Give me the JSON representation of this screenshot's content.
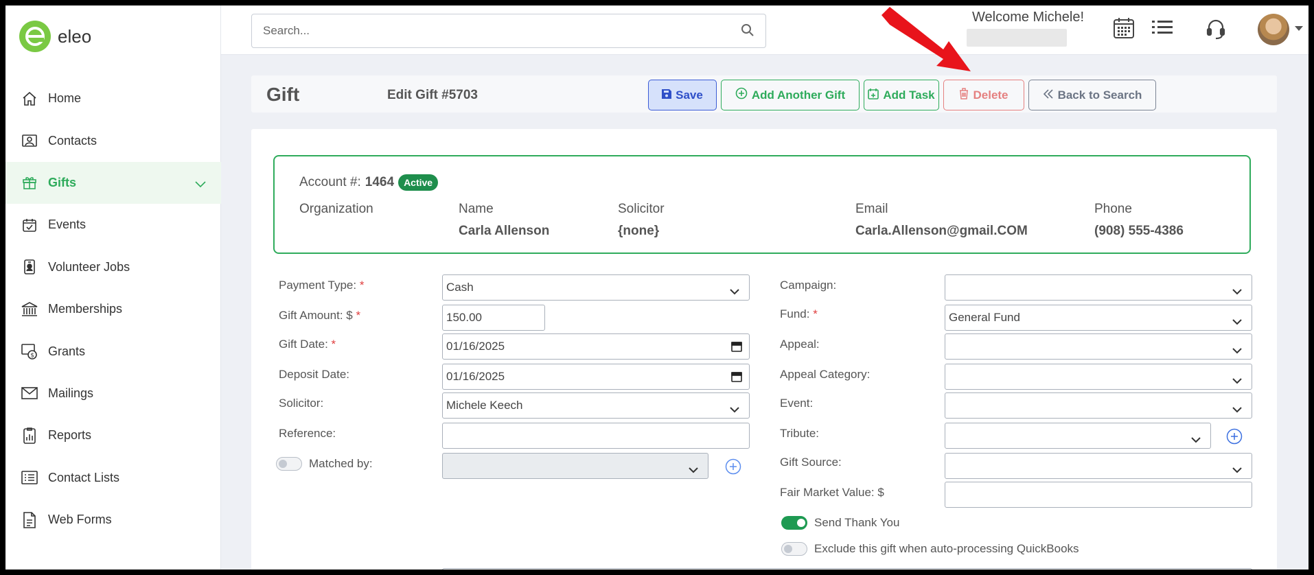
{
  "app": {
    "name": "eleo"
  },
  "sidebar": {
    "items": [
      {
        "label": "Home",
        "icon": "home-icon"
      },
      {
        "label": "Contacts",
        "icon": "contacts-icon"
      },
      {
        "label": "Gifts",
        "icon": "gift-icon",
        "active": true
      },
      {
        "label": "Events",
        "icon": "calendar-check-icon"
      },
      {
        "label": "Volunteer Jobs",
        "icon": "badge-icon"
      },
      {
        "label": "Memberships",
        "icon": "bank-icon"
      },
      {
        "label": "Grants",
        "icon": "grant-icon"
      },
      {
        "label": "Mailings",
        "icon": "envelope-icon"
      },
      {
        "label": "Reports",
        "icon": "report-icon"
      },
      {
        "label": "Contact Lists",
        "icon": "list-icon"
      },
      {
        "label": "Web Forms",
        "icon": "form-icon"
      }
    ]
  },
  "topbar": {
    "search_placeholder": "Search...",
    "welcome": "Welcome Michele!"
  },
  "header": {
    "title": "Gift",
    "edit_title": "Edit Gift #5703",
    "buttons": {
      "save": "Save",
      "add_another": "Add Another Gift",
      "add_task": "Add Task",
      "delete": "Delete",
      "back": "Back to Search"
    }
  },
  "account": {
    "label": "Account #:",
    "number": "1464",
    "status": "Active",
    "organization_label": "Organization",
    "organization_value": "",
    "name_label": "Name",
    "name_value": "Carla Allenson",
    "solicitor_label": "Solicitor",
    "solicitor_value": "{none}",
    "email_label": "Email",
    "email_value": "Carla.Allenson@gmail.COM",
    "phone_label": "Phone",
    "phone_value": "(908) 555-4386"
  },
  "form": {
    "payment_type": {
      "label": "Payment Type:",
      "value": "Cash"
    },
    "gift_amount": {
      "label": "Gift Amount: $",
      "value": "150.00"
    },
    "gift_date": {
      "label": "Gift Date:",
      "value": "01/16/2025"
    },
    "deposit_date": {
      "label": "Deposit Date:",
      "value": "01/16/2025"
    },
    "solicitor": {
      "label": "Solicitor:",
      "value": "Michele Keech"
    },
    "reference": {
      "label": "Reference:",
      "value": ""
    },
    "matched_by": {
      "label": "Matched by:",
      "value": ""
    },
    "campaign": {
      "label": "Campaign:",
      "value": ""
    },
    "fund": {
      "label": "Fund:",
      "value": "General Fund"
    },
    "appeal": {
      "label": "Appeal:",
      "value": ""
    },
    "appeal_category": {
      "label": "Appeal Category:",
      "value": ""
    },
    "event": {
      "label": "Event:",
      "value": ""
    },
    "tribute": {
      "label": "Tribute:",
      "value": ""
    },
    "gift_source": {
      "label": "Gift Source:",
      "value": ""
    },
    "fair_market_value": {
      "label": "Fair Market Value: $",
      "value": ""
    },
    "send_thank_you": {
      "label": "Send Thank You",
      "on": true
    },
    "exclude_quickbooks": {
      "label": "Exclude this gift when auto-processing QuickBooks",
      "on": false
    },
    "required_mark": "*"
  },
  "colors": {
    "brand_green": "#2eab5b",
    "save_blue": "#2f4fc8",
    "delete_red": "#e58080",
    "annotation_red": "#e8141b"
  }
}
